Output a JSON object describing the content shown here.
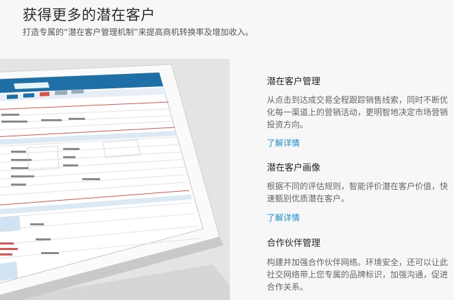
{
  "header": {
    "title": "获得更多的潜在客户",
    "subtitle": "打造专属的“潜在客户管理机制”来提高商机转换率及增加收入。"
  },
  "features": [
    {
      "title": "潜在客户管理",
      "description": "从点击到达成交易全程跟踪销售线索，同时不断优化每一渠道上的营销活动，更明智地决定市场营销投资方向。",
      "link": "了解详情"
    },
    {
      "title": "潜在客户画像",
      "description": "根据不同的评估规则，智能评价潜在客户价值，快速甄别优质潜在客户。",
      "link": "了解详情"
    },
    {
      "title": "合作伙伴管理",
      "description": "构建并加强合作伙伴网络。环境安全，还可以让此社交网络带上您专属的品牌标识，加强沟通，促进合作关系。"
    }
  ],
  "tablet_screen": {
    "accent_color": "#1d6fa5",
    "alert_color": "#d9534f"
  }
}
